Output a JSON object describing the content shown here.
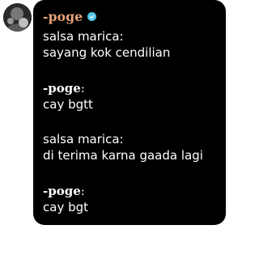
{
  "chat": {
    "sender": {
      "name": "-poge",
      "name_color": "#e8a278",
      "verified_color": "#4fc3e8"
    },
    "bubble_color": "#000000",
    "text_color": "#ffffff",
    "lines": [
      {
        "text": "salsa marica:"
      },
      {
        "text": "sayang kok cendilian"
      },
      {
        "author": "-poge",
        "suffix": ":"
      },
      {
        "text": "cay bgtt"
      },
      {
        "text": "salsa marica:"
      },
      {
        "text": "di terima karna gaada lagi"
      },
      {
        "author": "-poge",
        "suffix": ":"
      },
      {
        "text": "cay bgt"
      }
    ]
  }
}
